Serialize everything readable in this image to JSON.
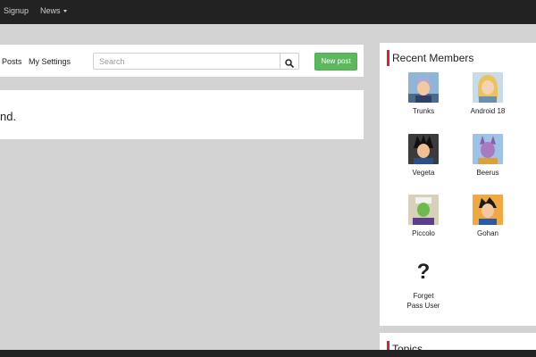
{
  "topnav": {
    "signup_label": "Signup",
    "news_label": "News"
  },
  "toolbar": {
    "posts_label": "Posts",
    "settings_label": "My Settings",
    "search_placeholder": "Search",
    "new_post_label": "New post"
  },
  "content": {
    "message_text": "nd."
  },
  "members": {
    "title": "Recent Members",
    "items": [
      {
        "name": "Trunks"
      },
      {
        "name": "Android 18"
      },
      {
        "name": "Vegeta"
      },
      {
        "name": "Beerus"
      },
      {
        "name": "Piccolo"
      },
      {
        "name": "Gohan"
      },
      {
        "name": "Forget Pass User"
      }
    ],
    "unknown_avatar_glyph": "?"
  },
  "topics": {
    "title": "Topics"
  },
  "colors": {
    "navbar": "#222222",
    "page_background": "#d3d3d3",
    "new_post_green": "#5cb85c",
    "title_accent_red": "#d9232d"
  }
}
